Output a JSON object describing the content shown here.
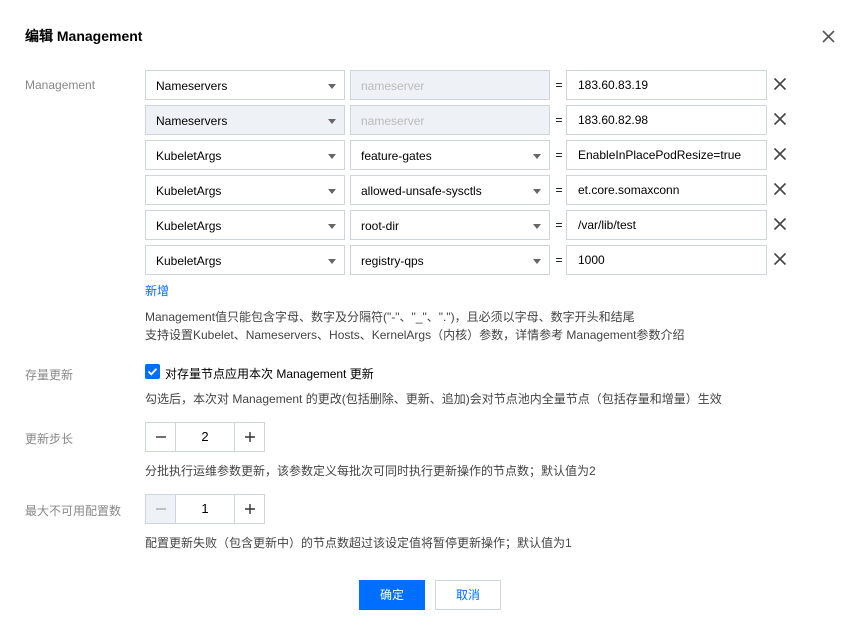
{
  "dialog": {
    "title": "编辑 Management",
    "close_icon": "close-icon"
  },
  "management": {
    "label": "Management",
    "rows": [
      {
        "type": "Nameservers",
        "type_disabled": false,
        "key": "",
        "key_placeholder": "nameserver",
        "key_disabled": true,
        "value": "183.60.83.19"
      },
      {
        "type": "Nameservers",
        "type_disabled": true,
        "key": "",
        "key_placeholder": "nameserver",
        "key_disabled": true,
        "value": "183.60.82.98"
      },
      {
        "type": "KubeletArgs",
        "type_disabled": false,
        "key": "feature-gates",
        "key_placeholder": "",
        "key_disabled": false,
        "value": "EnableInPlacePodResize=true"
      },
      {
        "type": "KubeletArgs",
        "type_disabled": false,
        "key": "allowed-unsafe-sysctls",
        "key_placeholder": "",
        "key_disabled": false,
        "value": "et.core.somaxconn"
      },
      {
        "type": "KubeletArgs",
        "type_disabled": false,
        "key": "root-dir",
        "key_placeholder": "",
        "key_disabled": false,
        "value": "/var/lib/test"
      },
      {
        "type": "KubeletArgs",
        "type_disabled": false,
        "key": "registry-qps",
        "key_placeholder": "",
        "key_disabled": false,
        "value": "1000"
      }
    ],
    "add_label": "新增",
    "tip_line1": "Management值只能包含字母、数字及分隔符(\"-\"、\"_\"、\".\")，且必须以字母、数字开头和结尾",
    "tip_line2": "支持设置Kubelet、Nameservers、Hosts、KernelArgs（内核）参数，详情参考 Management参数介绍"
  },
  "stock_update": {
    "label": "存量更新",
    "checked": true,
    "checkbox_label": "对存量节点应用本次 Management 更新",
    "tip": "勾选后，本次对 Management 的更改(包括删除、更新、追加)会对节点池内全量节点（包括存量和增量）生效"
  },
  "update_step": {
    "label": "更新步长",
    "value": "2",
    "tip": "分批执行运维参数更新，该参数定义每批次可同时执行更新操作的节点数；默认值为2"
  },
  "max_unavailable": {
    "label": "最大不可用配置数",
    "value": "1",
    "tip": "配置更新失败（包含更新中）的节点数超过该设定值将暂停更新操作；默认值为1"
  },
  "footer": {
    "confirm_label": "确定",
    "cancel_label": "取消"
  },
  "colors": {
    "primary": "#006eff",
    "border": "#cfd5de",
    "disabled_bg": "#eef1f5",
    "label": "#888888"
  }
}
